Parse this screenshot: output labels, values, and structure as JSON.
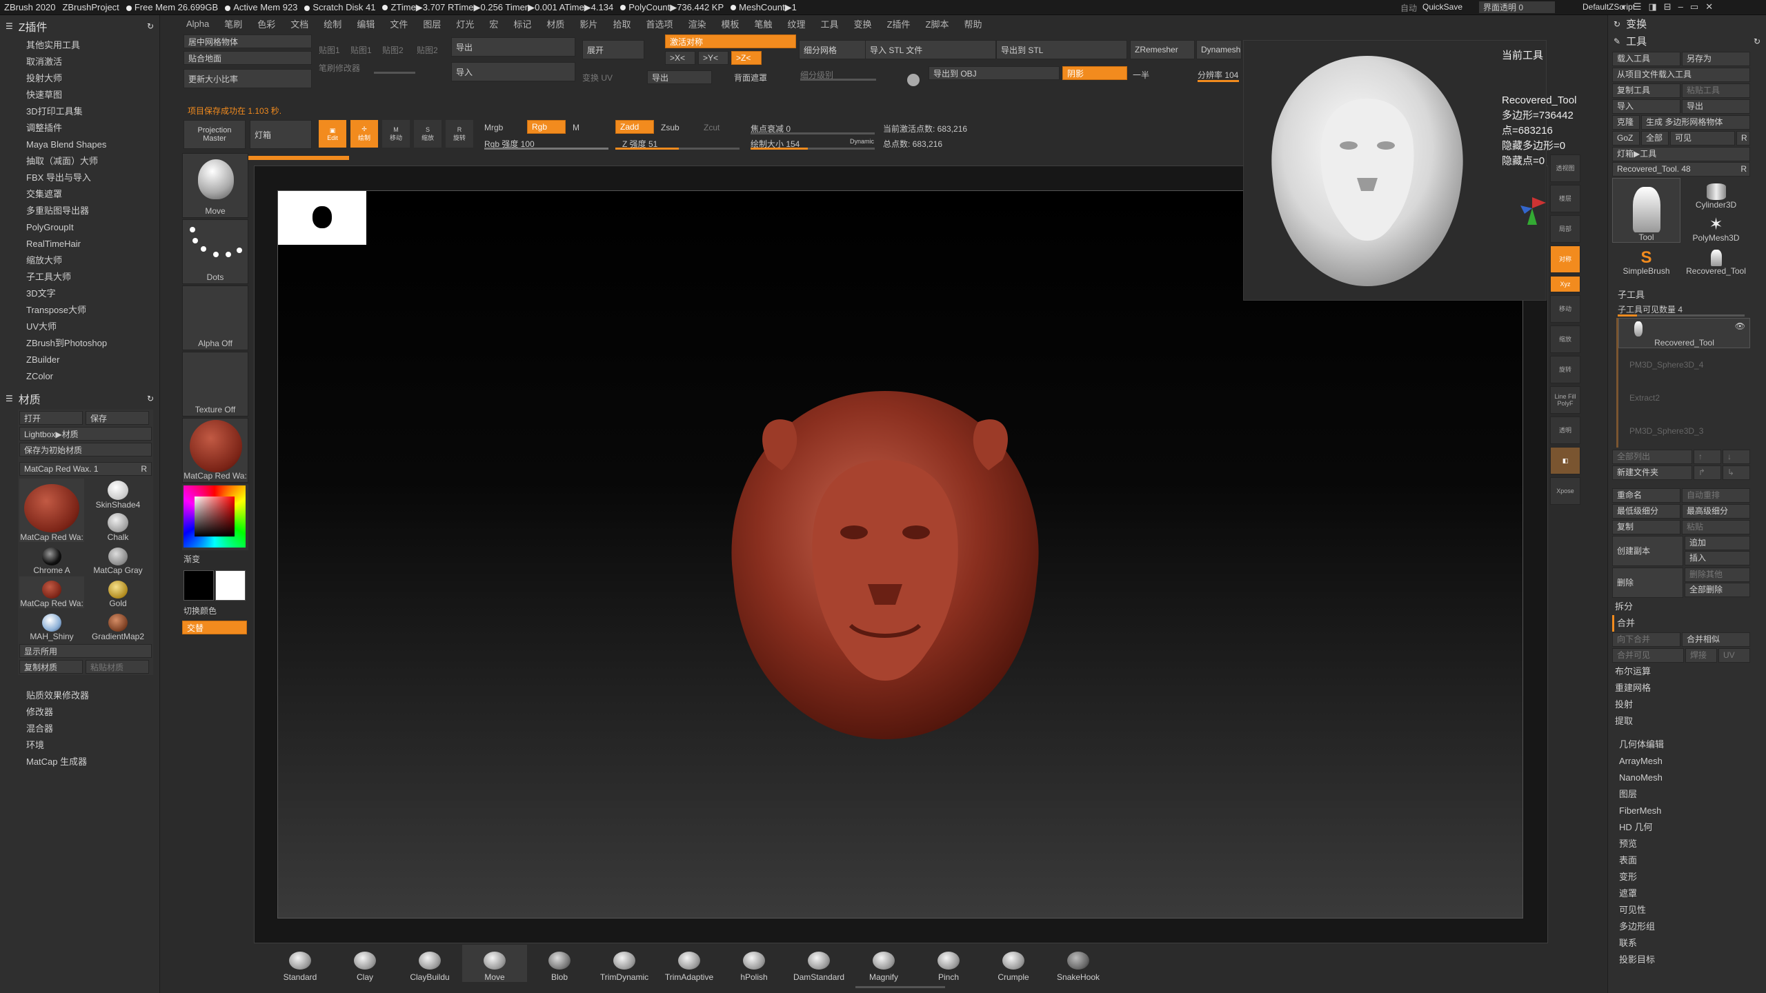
{
  "titlebar": {
    "app": "ZBrush 2020",
    "project": "ZBrushProject",
    "stats": [
      "Free Mem 26.699GB",
      "Active Mem 923",
      "Scratch Disk 41",
      "ZTime▶3.707 RTime▶0.256 Timer▶0.001 ATime▶4.134",
      "PolyCount▶736.442 KP",
      "MeshCount▶1"
    ],
    "auto": "自动",
    "quicksave": "QuickSave",
    "ui_transparency": "界面透明 0",
    "script": "DefaultZScript"
  },
  "menu": [
    "Alpha",
    "笔刷",
    "色彩",
    "文档",
    "绘制",
    "编辑",
    "文件",
    "图层",
    "灯光",
    "宏",
    "标记",
    "材质",
    "影片",
    "拾取",
    "首选项",
    "渲染",
    "模板",
    "笔触",
    "纹理",
    "工具",
    "变换",
    "Z插件",
    "Z脚本",
    "帮助"
  ],
  "left": {
    "zplugin_title": "Z插件",
    "plugins": [
      "其他实用工具",
      "取消激活",
      "投射大师",
      "快速草图",
      "3D打印工具集",
      "调整插件",
      "Maya Blend Shapes",
      "抽取（减面）大师",
      "FBX 导出与导入",
      "交集遮罩",
      "多重贴图导出器",
      "PolyGroupIt",
      "RealTimeHair",
      "缩放大师",
      "子工具大师",
      "3D文字",
      "Transpose大师",
      "UV大师",
      "ZBrush到Photoshop",
      "ZBuilder",
      "ZColor"
    ],
    "material_title": "材质",
    "mat_open": "打开",
    "mat_save": "保存",
    "mat_lightbox": "Lightbox▶材质",
    "mat_save_startup": "保存为初始材质",
    "mat_current": "MatCap Red Wax. 1",
    "mat_r": "R",
    "materials": [
      "MatCap Red Wa:",
      "SkinShade4",
      "Chalk",
      "Chrome A",
      "MatCap Gray",
      "MatCap Red Wa:",
      "Gold",
      "MAH_Shiny",
      "GradientMap2"
    ],
    "mat_show_used": "显示所用",
    "mat_copy": "复制材质",
    "mat_paste": "粘贴材质",
    "mat_sections": [
      "贴质效果修改器",
      "修改器",
      "混合器",
      "环境",
      "MatCap 生成器"
    ]
  },
  "top_controls": {
    "center_mesh": "居中网格物体",
    "fit_ground": "贴合地面",
    "update_scale": "更新大小比率",
    "save_msg": "项目保存成功在 1.103 秒.",
    "map1": "贴图1",
    "map2": "贴图1",
    "map3": "贴图2",
    "map4": "贴图2",
    "pen_mod": "笔刷修改器",
    "export": "导出",
    "import": "导入",
    "unfold": "展开",
    "transform_uv": "变换 UV",
    "activate_sym": "激活对称",
    "x_axis": ">X<",
    "y_axis": ">Y<",
    "z_axis": ">Z<",
    "export2": "导出",
    "back_mask": "背面遮罩",
    "subdiv": "细分网格",
    "subdiv_level": "细分级别",
    "import_stl": "导入 STL 文件",
    "export_stl": "导出到 STL",
    "export_obj": "导出到 OBJ",
    "shadow": "阴影",
    "zremesher": "ZRemesher",
    "half": "一半",
    "dynamesh": "Dynamesh",
    "resolution": "分辨率 104",
    "proj_master": "Projection Master",
    "lightbox": "灯箱",
    "edit": "Edit",
    "draw": "绘制",
    "move_btn": "移动",
    "scale_btn": "缩放",
    "rotate_btn": "旋转",
    "mrgb": "Mrgb",
    "rgb": "Rgb",
    "m": "M",
    "rgb_intensity": "Rgb 强度 100",
    "zadd": "Zadd",
    "zsub": "Zsub",
    "zcut": "Zcut",
    "z_intensity": "Z 强度 51",
    "focal_shift": "焦点衰减 0",
    "draw_size": "绘制大小 154",
    "dynamic": "Dynamic",
    "active_points": "当前激活点数: 683,216",
    "total_points": "总点数: 683,216"
  },
  "shelf": {
    "tiles": [
      "Move",
      "Dots",
      "Alpha Off",
      "Texture Off",
      "MatCap Red Wa:"
    ],
    "gradient": "渐变",
    "switch_color": "切换颜色",
    "alternate": "交替"
  },
  "preview": {
    "title": "当前工具",
    "tool_name": "Recovered_Tool",
    "polys": "多边形=736442",
    "points": "点=683216",
    "hidden_polys": "隐藏多边形=0",
    "hidden_points": "隐藏点=0"
  },
  "vertical_tools": [
    "透视图",
    "楼层",
    "局部",
    "对称",
    "Xyz",
    "移动",
    "缩放",
    "旋转",
    "Line Fill PolyF",
    "透明",
    "Xpose"
  ],
  "right": {
    "transform": "变换",
    "tool": "工具",
    "load_tool": "载入工具",
    "save_as": "另存为",
    "load_from_project": "从项目文件载入工具",
    "copy_tool": "复制工具",
    "paste_tool": "粘贴工具",
    "import": "导入",
    "export": "导出",
    "clone": "克隆",
    "make_polymesh": "生成 多边形网格物体",
    "goz": "GoZ",
    "all": "全部",
    "visible": "可见",
    "r": "R",
    "lightbox_tool": "灯箱▶工具",
    "tool_slider": "Recovered_Tool. 48",
    "tools": [
      "Tool",
      "Cylinder3D",
      "PolyMesh3D",
      "SimpleBrush",
      "Recovered_Tool"
    ],
    "subtool": "子工具",
    "subtool_count": "子工具可见数量 4",
    "subtools": [
      "Recovered_Tool",
      "PM3D_Sphere3D_4",
      "Extract2",
      "PM3D_Sphere3D_3"
    ],
    "list_all": "全部列出",
    "new_folder": "新建文件夹",
    "rename": "重命名",
    "auto_reorder": "自动重排",
    "lowest_subdiv": "最低级细分",
    "highest_subdiv": "最高级细分",
    "copy": "复制",
    "paste": "粘贴",
    "duplicate": "创建副本",
    "append": "追加",
    "insert": "插入",
    "delete": "删除",
    "del_other": "删除其他",
    "del_all": "全部删除",
    "split": "拆分",
    "merge": "合并",
    "merge_down": "向下合并",
    "merge_similar": "合并相似",
    "merge_visible": "合并可见",
    "weld": "焊接",
    "uv": "UV",
    "boolean": "布尔运算",
    "remesh": "重建网格",
    "project": "投射",
    "extract": "提取",
    "sections": [
      "几何体编辑",
      "ArrayMesh",
      "NanoMesh",
      "图层",
      "FiberMesh",
      "HD 几何",
      "预览",
      "表面",
      "变形",
      "遮罩",
      "可见性",
      "多边形组",
      "联系",
      "投影目标"
    ]
  },
  "brushes": [
    "Standard",
    "Clay",
    "ClayBuildu",
    "Move",
    "Blob",
    "TrimDynamic",
    "TrimAdaptive",
    "hPolish",
    "DamStandard",
    "Magnify",
    "Pinch",
    "Crumple",
    "SnakeHook"
  ]
}
